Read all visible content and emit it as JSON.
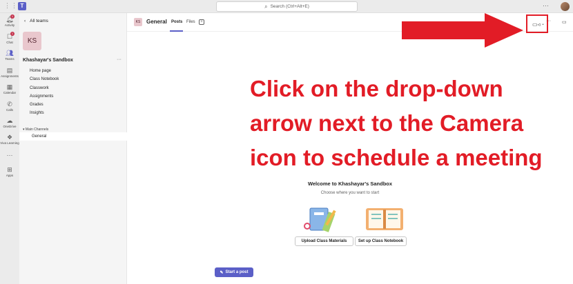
{
  "topbar": {
    "search_placeholder": "Search (Ctrl+Alt+E)",
    "more_label": "···"
  },
  "rail": [
    {
      "label": "Activity",
      "icon": "bell-icon",
      "badge": "1"
    },
    {
      "label": "Chat",
      "icon": "chat-icon",
      "badge": "1"
    },
    {
      "label": "Teams",
      "icon": "teams-icon",
      "active": true
    },
    {
      "label": "Assignments",
      "icon": "assignments-icon"
    },
    {
      "label": "Calendar",
      "icon": "calendar-icon"
    },
    {
      "label": "Calls",
      "icon": "phone-icon"
    },
    {
      "label": "OneDrive",
      "icon": "cloud-icon"
    },
    {
      "label": "Viva Learning",
      "icon": "learning-icon"
    },
    {
      "label": "···",
      "icon": "more-icon"
    },
    {
      "label": "Apps",
      "icon": "apps-icon"
    }
  ],
  "sidebar": {
    "back_label": "All teams",
    "team_initials": "KS",
    "team_name": "Khashayar's Sandbox",
    "nav": [
      "Home page",
      "Class Notebook",
      "Classwork",
      "Assignments",
      "Grades",
      "Insights"
    ],
    "section_label": "Main Channels",
    "channel": "General"
  },
  "header": {
    "initials": "KS",
    "title": "General",
    "tabs": [
      "Posts",
      "Files"
    ],
    "add_tab": "+"
  },
  "instruction": {
    "line1": "Click on the drop-down",
    "line2": "arrow next to the Camera",
    "line3": "icon to schedule a meeting"
  },
  "welcome": {
    "title": "Welcome to Khashayar's Sandbox",
    "subtitle": "Choose where you want to start",
    "btn_materials": "Upload Class Materials",
    "btn_notebook": "Set up Class Notebook"
  },
  "compose": {
    "start_post": "Start a post"
  },
  "colors": {
    "accent": "#5b5fc7",
    "annotation": "#e21c26"
  }
}
